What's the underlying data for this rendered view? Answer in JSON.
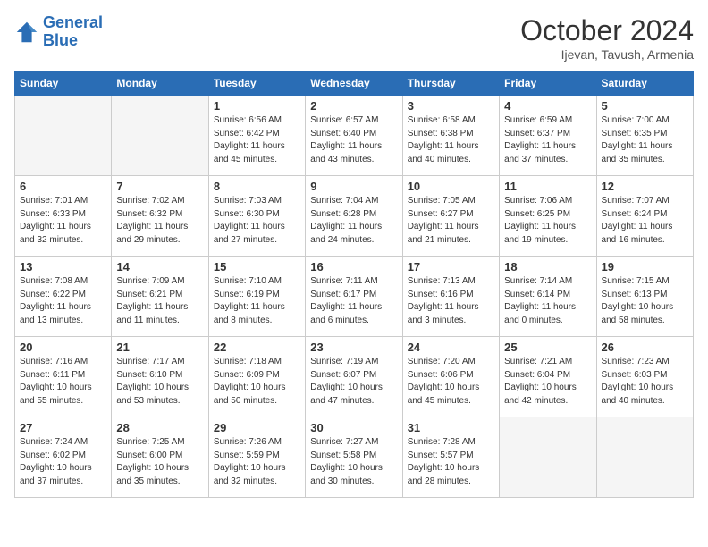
{
  "logo": {
    "line1": "General",
    "line2": "Blue"
  },
  "title": "October 2024",
  "location": "Ijevan, Tavush, Armenia",
  "weekdays": [
    "Sunday",
    "Monday",
    "Tuesday",
    "Wednesday",
    "Thursday",
    "Friday",
    "Saturday"
  ],
  "weeks": [
    [
      {
        "day": "",
        "empty": true
      },
      {
        "day": "",
        "empty": true
      },
      {
        "day": "1",
        "sunrise": "6:56 AM",
        "sunset": "6:42 PM",
        "daylight": "11 hours and 45 minutes."
      },
      {
        "day": "2",
        "sunrise": "6:57 AM",
        "sunset": "6:40 PM",
        "daylight": "11 hours and 43 minutes."
      },
      {
        "day": "3",
        "sunrise": "6:58 AM",
        "sunset": "6:38 PM",
        "daylight": "11 hours and 40 minutes."
      },
      {
        "day": "4",
        "sunrise": "6:59 AM",
        "sunset": "6:37 PM",
        "daylight": "11 hours and 37 minutes."
      },
      {
        "day": "5",
        "sunrise": "7:00 AM",
        "sunset": "6:35 PM",
        "daylight": "11 hours and 35 minutes."
      }
    ],
    [
      {
        "day": "6",
        "sunrise": "7:01 AM",
        "sunset": "6:33 PM",
        "daylight": "11 hours and 32 minutes."
      },
      {
        "day": "7",
        "sunrise": "7:02 AM",
        "sunset": "6:32 PM",
        "daylight": "11 hours and 29 minutes."
      },
      {
        "day": "8",
        "sunrise": "7:03 AM",
        "sunset": "6:30 PM",
        "daylight": "11 hours and 27 minutes."
      },
      {
        "day": "9",
        "sunrise": "7:04 AM",
        "sunset": "6:28 PM",
        "daylight": "11 hours and 24 minutes."
      },
      {
        "day": "10",
        "sunrise": "7:05 AM",
        "sunset": "6:27 PM",
        "daylight": "11 hours and 21 minutes."
      },
      {
        "day": "11",
        "sunrise": "7:06 AM",
        "sunset": "6:25 PM",
        "daylight": "11 hours and 19 minutes."
      },
      {
        "day": "12",
        "sunrise": "7:07 AM",
        "sunset": "6:24 PM",
        "daylight": "11 hours and 16 minutes."
      }
    ],
    [
      {
        "day": "13",
        "sunrise": "7:08 AM",
        "sunset": "6:22 PM",
        "daylight": "11 hours and 13 minutes."
      },
      {
        "day": "14",
        "sunrise": "7:09 AM",
        "sunset": "6:21 PM",
        "daylight": "11 hours and 11 minutes."
      },
      {
        "day": "15",
        "sunrise": "7:10 AM",
        "sunset": "6:19 PM",
        "daylight": "11 hours and 8 minutes."
      },
      {
        "day": "16",
        "sunrise": "7:11 AM",
        "sunset": "6:17 PM",
        "daylight": "11 hours and 6 minutes."
      },
      {
        "day": "17",
        "sunrise": "7:13 AM",
        "sunset": "6:16 PM",
        "daylight": "11 hours and 3 minutes."
      },
      {
        "day": "18",
        "sunrise": "7:14 AM",
        "sunset": "6:14 PM",
        "daylight": "11 hours and 0 minutes."
      },
      {
        "day": "19",
        "sunrise": "7:15 AM",
        "sunset": "6:13 PM",
        "daylight": "10 hours and 58 minutes."
      }
    ],
    [
      {
        "day": "20",
        "sunrise": "7:16 AM",
        "sunset": "6:11 PM",
        "daylight": "10 hours and 55 minutes."
      },
      {
        "day": "21",
        "sunrise": "7:17 AM",
        "sunset": "6:10 PM",
        "daylight": "10 hours and 53 minutes."
      },
      {
        "day": "22",
        "sunrise": "7:18 AM",
        "sunset": "6:09 PM",
        "daylight": "10 hours and 50 minutes."
      },
      {
        "day": "23",
        "sunrise": "7:19 AM",
        "sunset": "6:07 PM",
        "daylight": "10 hours and 47 minutes."
      },
      {
        "day": "24",
        "sunrise": "7:20 AM",
        "sunset": "6:06 PM",
        "daylight": "10 hours and 45 minutes."
      },
      {
        "day": "25",
        "sunrise": "7:21 AM",
        "sunset": "6:04 PM",
        "daylight": "10 hours and 42 minutes."
      },
      {
        "day": "26",
        "sunrise": "7:23 AM",
        "sunset": "6:03 PM",
        "daylight": "10 hours and 40 minutes."
      }
    ],
    [
      {
        "day": "27",
        "sunrise": "7:24 AM",
        "sunset": "6:02 PM",
        "daylight": "10 hours and 37 minutes."
      },
      {
        "day": "28",
        "sunrise": "7:25 AM",
        "sunset": "6:00 PM",
        "daylight": "10 hours and 35 minutes."
      },
      {
        "day": "29",
        "sunrise": "7:26 AM",
        "sunset": "5:59 PM",
        "daylight": "10 hours and 32 minutes."
      },
      {
        "day": "30",
        "sunrise": "7:27 AM",
        "sunset": "5:58 PM",
        "daylight": "10 hours and 30 minutes."
      },
      {
        "day": "31",
        "sunrise": "7:28 AM",
        "sunset": "5:57 PM",
        "daylight": "10 hours and 28 minutes."
      },
      {
        "day": "",
        "empty": true
      },
      {
        "day": "",
        "empty": true
      }
    ]
  ]
}
